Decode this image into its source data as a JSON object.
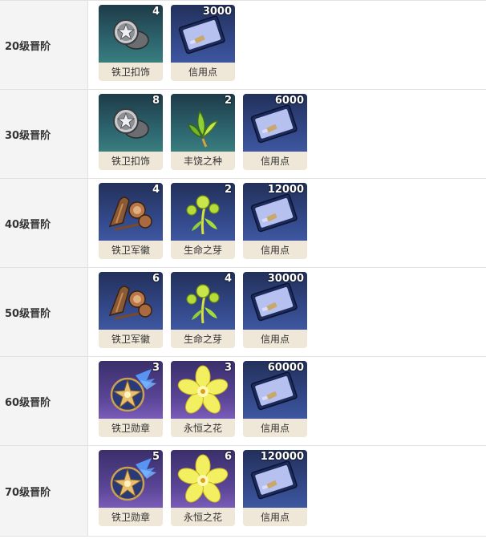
{
  "rows": [
    {
      "level": "20级晋阶",
      "items": [
        {
          "name": "铁卫扣饰",
          "qty": "4",
          "icon": "silver-badge-icon",
          "bg": "teal"
        },
        {
          "name": "信用点",
          "qty": "3000",
          "icon": "credit-card-icon",
          "bg": "blue"
        }
      ]
    },
    {
      "level": "30级晋阶",
      "items": [
        {
          "name": "铁卫扣饰",
          "qty": "8",
          "icon": "silver-badge-icon",
          "bg": "teal"
        },
        {
          "name": "丰饶之种",
          "qty": "2",
          "icon": "green-seed-icon",
          "bg": "teal"
        },
        {
          "name": "信用点",
          "qty": "6000",
          "icon": "credit-card-icon",
          "bg": "blue"
        }
      ]
    },
    {
      "level": "40级晋阶",
      "items": [
        {
          "name": "铁卫军徽",
          "qty": "4",
          "icon": "bronze-emblem-icon",
          "bg": "blue"
        },
        {
          "name": "生命之芽",
          "qty": "2",
          "icon": "sprout-icon",
          "bg": "blue"
        },
        {
          "name": "信用点",
          "qty": "12000",
          "icon": "credit-card-icon",
          "bg": "blue"
        }
      ]
    },
    {
      "level": "50级晋阶",
      "items": [
        {
          "name": "铁卫军徽",
          "qty": "6",
          "icon": "bronze-emblem-icon",
          "bg": "blue"
        },
        {
          "name": "生命之芽",
          "qty": "4",
          "icon": "sprout-icon",
          "bg": "blue"
        },
        {
          "name": "信用点",
          "qty": "30000",
          "icon": "credit-card-icon",
          "bg": "blue"
        }
      ]
    },
    {
      "level": "60级晋阶",
      "items": [
        {
          "name": "铁卫勋章",
          "qty": "3",
          "icon": "golden-medal-icon",
          "bg": "purple"
        },
        {
          "name": "永恒之花",
          "qty": "3",
          "icon": "yellow-flower-icon",
          "bg": "purple"
        },
        {
          "name": "信用点",
          "qty": "60000",
          "icon": "credit-card-icon",
          "bg": "blue"
        }
      ]
    },
    {
      "level": "70级晋阶",
      "items": [
        {
          "name": "铁卫勋章",
          "qty": "5",
          "icon": "golden-medal-icon",
          "bg": "purple"
        },
        {
          "name": "永恒之花",
          "qty": "6",
          "icon": "yellow-flower-icon",
          "bg": "purple"
        },
        {
          "name": "信用点",
          "qty": "120000",
          "icon": "credit-card-icon",
          "bg": "blue"
        }
      ]
    }
  ]
}
